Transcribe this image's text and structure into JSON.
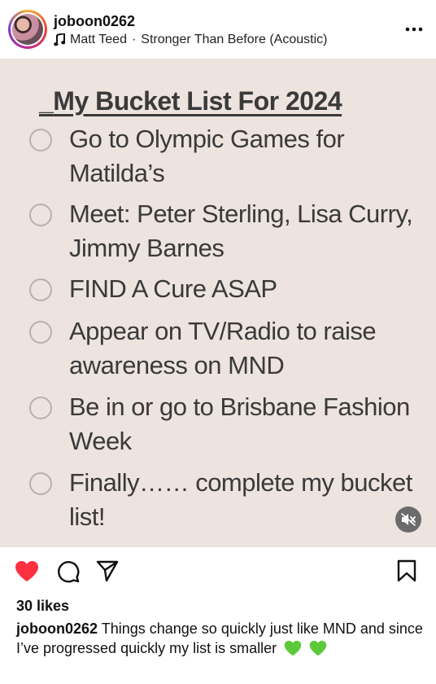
{
  "header": {
    "username": "joboon0262",
    "audio_artist": "Matt Teed",
    "audio_separator": "·",
    "audio_track": "Stronger Than Before (Acoustic)"
  },
  "media": {
    "background_color": "#ede3df",
    "title_prefix": "_",
    "title": "My Bucket List For 2024",
    "items": [
      {
        "text": "Go to Olympic Games for Matilda’s",
        "checked": false
      },
      {
        "text": "Meet: Peter Sterling, Lisa Curry, Jimmy Barnes",
        "checked": false
      },
      {
        "text": "FIND A Cure ASAP",
        "checked": false
      },
      {
        "text": "Appear on TV/Radio to raise awareness on MND",
        "checked": false
      },
      {
        "text": "Be in or go to Brisbane Fashion Week",
        "checked": false
      },
      {
        "text": "Finally…… complete my bucket list!",
        "checked": false
      }
    ],
    "mute_icon": "speaker-muted-icon"
  },
  "actions": {
    "like_icon": "heart-filled-icon",
    "like_color": "#ff3040",
    "comment_icon": "comment-bubble-icon",
    "share_icon": "paper-plane-icon",
    "save_icon": "bookmark-icon"
  },
  "likes_text": "30 likes",
  "caption": {
    "username": "joboon0262",
    "text": "Things change so quickly just like MND and since I’ve progressed quickly my list is smaller",
    "emoji_icon": "green-heart-emoji",
    "emoji_color": "#5cc93b"
  }
}
